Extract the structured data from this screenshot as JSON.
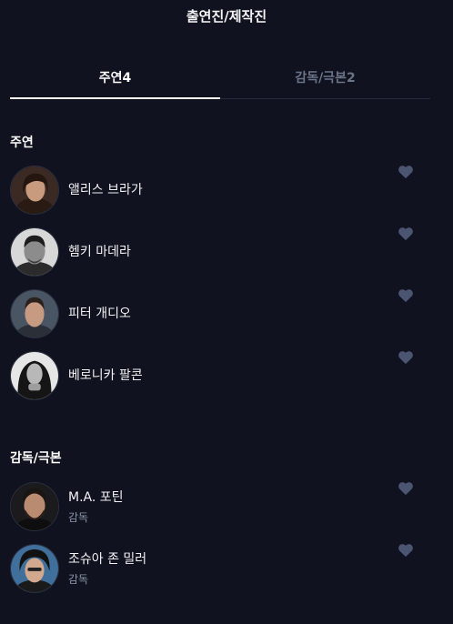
{
  "header": {
    "title": "출연진/제작진"
  },
  "tabs": [
    {
      "label": "주연4",
      "active": true
    },
    {
      "label": "감독/극본2",
      "active": false
    }
  ],
  "sections": {
    "cast": {
      "title": "주연",
      "people": [
        {
          "name": "앨리스 브라가"
        },
        {
          "name": "헴키 마데라"
        },
        {
          "name": "피터 개디오"
        },
        {
          "name": "베로니카 팔콘"
        }
      ]
    },
    "crew": {
      "title": "감독/극본",
      "people": [
        {
          "name": "M.A. 포틴",
          "role": "감독"
        },
        {
          "name": "조슈아 존 밀러",
          "role": "감독"
        }
      ]
    }
  },
  "icons": {
    "like": "heart-icon"
  },
  "colors": {
    "background": "#10131f",
    "heart": "#4b5470",
    "active_tab_underline": "#ffffff"
  }
}
